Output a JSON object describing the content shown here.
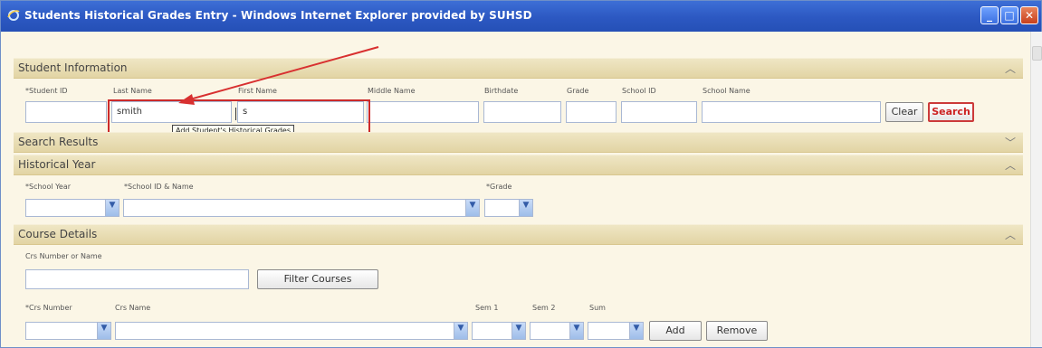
{
  "window": {
    "title": "Students Historical Grades Entry - Windows Internet Explorer provided by SUHSD",
    "controls": [
      "minimize",
      "maximize",
      "close"
    ]
  },
  "student_information": {
    "header": "Student Information",
    "fields": {
      "student_id": {
        "label": "*Student ID",
        "value": ""
      },
      "last_name": {
        "label": "Last Name",
        "value": "smith"
      },
      "first_name": {
        "label": "First Name",
        "value": "s"
      },
      "middle_name": {
        "label": "Middle Name",
        "value": ""
      },
      "birthdate": {
        "label": "Birthdate",
        "value": ""
      },
      "grade": {
        "label": "Grade",
        "value": ""
      },
      "school_id": {
        "label": "School ID",
        "value": ""
      },
      "school_name": {
        "label": "School Name",
        "value": ""
      }
    },
    "clear_label": "Clear",
    "search_label": "Search",
    "tooltip": "Add Student's Historical Grades"
  },
  "search_results": {
    "header": "Search Results"
  },
  "historical_year": {
    "header": "Historical Year",
    "school_year_label": "*School Year",
    "school_label": "*School ID & Name",
    "grade_label": "*Grade"
  },
  "course_details": {
    "header": "Course Details",
    "crs_filter_label": "Crs Number or Name",
    "filter_button": "Filter Courses",
    "crs_number_label": "*Crs Number",
    "crs_name_label": "Crs Name",
    "sem1_label": "Sem 1",
    "sem2_label": "Sem 2",
    "sum_label": "Sum",
    "add_button": "Add",
    "remove_button": "Remove"
  },
  "colors": {
    "titlebar": "#2c58c2",
    "band": "#e8dcb2",
    "highlight": "#cc2a2a",
    "search_text": "#cc2222"
  },
  "icons": {
    "app": "ie-logo-icon",
    "collapse": "chevron-up-icon",
    "expand": "chevron-down-icon",
    "dropdown": "dropdown-arrow-icon"
  }
}
